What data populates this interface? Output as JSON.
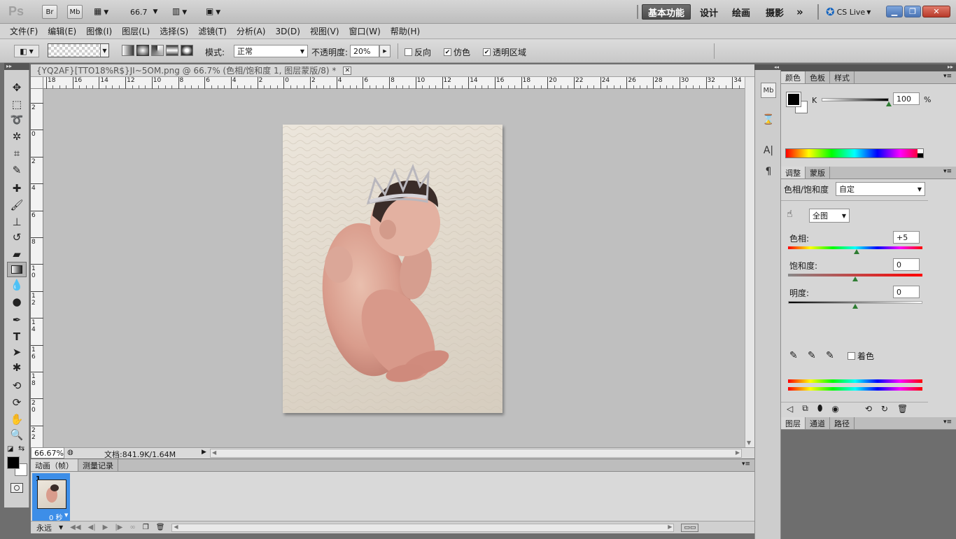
{
  "app": {
    "logo": "Ps",
    "bridge_label": "Br",
    "minibridge_label": "Mb",
    "zoom_value": "66.7",
    "workspaces": [
      "基本功能",
      "设计",
      "绘画",
      "摄影"
    ],
    "more_label": "»",
    "cslive_label": "CS Live"
  },
  "menu": [
    "文件(F)",
    "编辑(E)",
    "图像(I)",
    "图层(L)",
    "选择(S)",
    "滤镜(T)",
    "分析(A)",
    "3D(D)",
    "视图(V)",
    "窗口(W)",
    "帮助(H)"
  ],
  "options": {
    "mode_label": "模式:",
    "mode_value": "正常",
    "opacity_label": "不透明度:",
    "opacity_value": "20%",
    "reverse_label": "反向",
    "reverse_checked": false,
    "dither_label": "仿色",
    "dither_checked": true,
    "transparency_label": "透明区域",
    "transparency_checked": true
  },
  "document": {
    "tab_title": "{YQ2AF}[TTO18%R$}JI~5OM.png @ 66.7% (色相/饱和度 1, 图层蒙版/8) *",
    "zoom_status": "66.67%",
    "doc_info": "文档:841.9K/1.64M",
    "ruler_h": [
      "18",
      "16",
      "14",
      "12",
      "10",
      "8",
      "6",
      "4",
      "2",
      "0",
      "2",
      "4",
      "6",
      "8",
      "10",
      "12",
      "14",
      "16",
      "18",
      "20",
      "22",
      "24",
      "26",
      "28",
      "30",
      "32",
      "34"
    ],
    "ruler_v": [
      "2",
      "0",
      "2",
      "4",
      "6",
      "8",
      "10",
      "12",
      "14",
      "16",
      "18",
      "20",
      "22"
    ]
  },
  "animation": {
    "tabs": [
      "动画（帧）",
      "测量记录"
    ],
    "frame_number": "1",
    "frame_delay": "0 秒",
    "loop_value": "永远"
  },
  "color_panel": {
    "tabs": [
      "颜色",
      "色板",
      "样式"
    ],
    "channel_label": "K",
    "channel_value": "100",
    "percent": "%"
  },
  "adjust_panel": {
    "tabs": [
      "调整",
      "蒙版"
    ],
    "title": "色相/饱和度",
    "preset_value": "自定",
    "range_value": "全图",
    "hue_label": "色相:",
    "hue_value": "+5",
    "hue_fraction": 0.51,
    "sat_label": "饱和度:",
    "sat_value": "0",
    "sat_fraction": 0.5,
    "light_label": "明度:",
    "light_value": "0",
    "light_fraction": 0.5,
    "colorize_label": "着色",
    "colorize_checked": false
  },
  "layers_panel": {
    "tabs": [
      "图层",
      "通道",
      "路径"
    ]
  },
  "colors": {
    "workspace_active": "#555555",
    "canvas_bg": "#bfbfbf",
    "selection_blue": "#3d8ee8"
  }
}
